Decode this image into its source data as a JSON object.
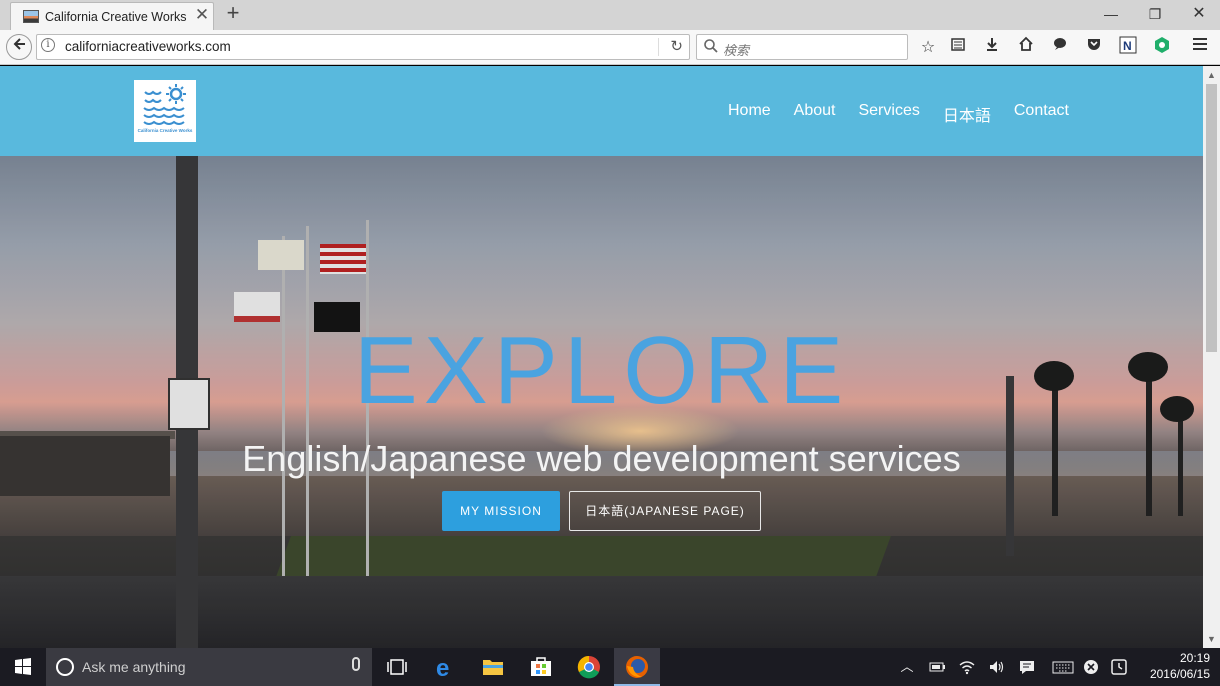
{
  "browser": {
    "tab": {
      "title": "California Creative Works ...",
      "close_glyph": "✕"
    },
    "new_tab_glyph": "+",
    "window_controls": {
      "minimize": "—",
      "restore": "❐",
      "close": "✕"
    },
    "address": {
      "url": "californiacreativeworks.com",
      "info_glyph": "i"
    },
    "search": {
      "placeholder": "検索"
    }
  },
  "site": {
    "logo_text": "California Creative Works",
    "nav": [
      "Home",
      "About",
      "Services",
      "日本語",
      "Contact"
    ],
    "hero": {
      "title": "EXPLORE",
      "subtitle": "English/Japanese web development services",
      "primary_button": "MY MISSION",
      "secondary_button": "日本語(JAPANESE PAGE)"
    },
    "colors": {
      "header": "#59b9dd",
      "accent": "#2d9fde",
      "title": "#4aa3e0"
    }
  },
  "taskbar": {
    "search_placeholder": "Ask me anything",
    "apps": [
      "task-view",
      "edge",
      "file-explorer",
      "store",
      "chrome",
      "firefox"
    ],
    "clock": {
      "time": "20:19",
      "date": "2016/06/15"
    }
  }
}
